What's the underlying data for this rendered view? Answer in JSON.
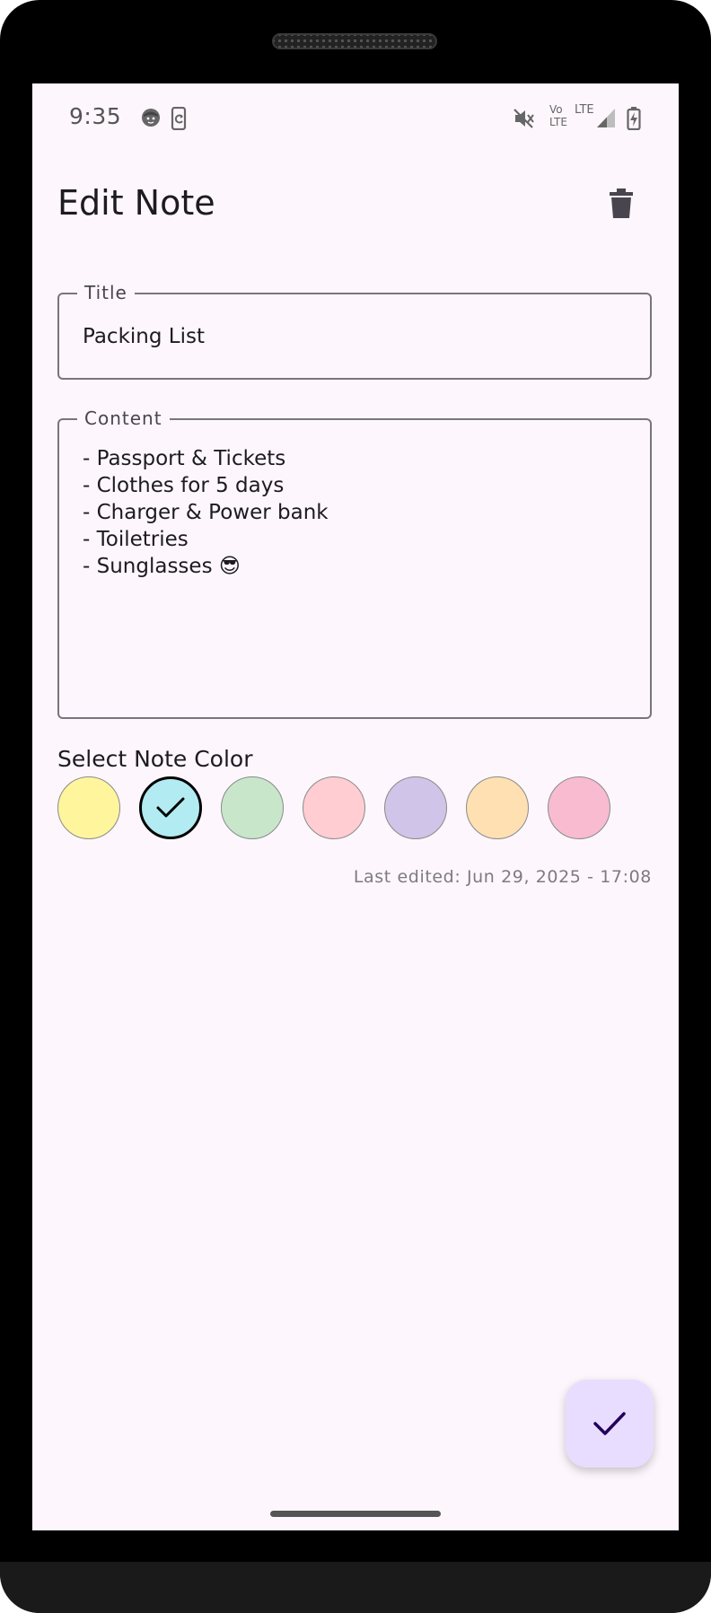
{
  "status_bar": {
    "time": "9:35",
    "network_label_top": "Vo",
    "network_label_bottom": "LTE",
    "lte_label": "LTE",
    "icons": [
      "face-icon",
      "phone-sync-icon",
      "mute-icon",
      "volte-icon",
      "signal-icon",
      "battery-charging-icon"
    ]
  },
  "app_bar": {
    "title": "Edit Note",
    "delete_icon": "trash-icon"
  },
  "form": {
    "title_label": "Title",
    "title_value": "Packing List",
    "content_label": "Content",
    "content_value": "- Passport & Tickets\n- Clothes for 5 days\n- Charger & Power bank\n- Toiletries\n- Sunglasses 😎"
  },
  "colors": {
    "heading": "Select Note Color",
    "selected_index": 1,
    "options": [
      "#fff59d",
      "#b2ebf2",
      "#c8e6c9",
      "#ffcdd2",
      "#d1c4e9",
      "#ffe0b2",
      "#f8bbd0"
    ]
  },
  "last_edited": "Last edited: Jun 29, 2025 - 17:08",
  "fab": {
    "icon": "check-icon",
    "background": "#e9ddff",
    "icon_color": "#21005d"
  }
}
